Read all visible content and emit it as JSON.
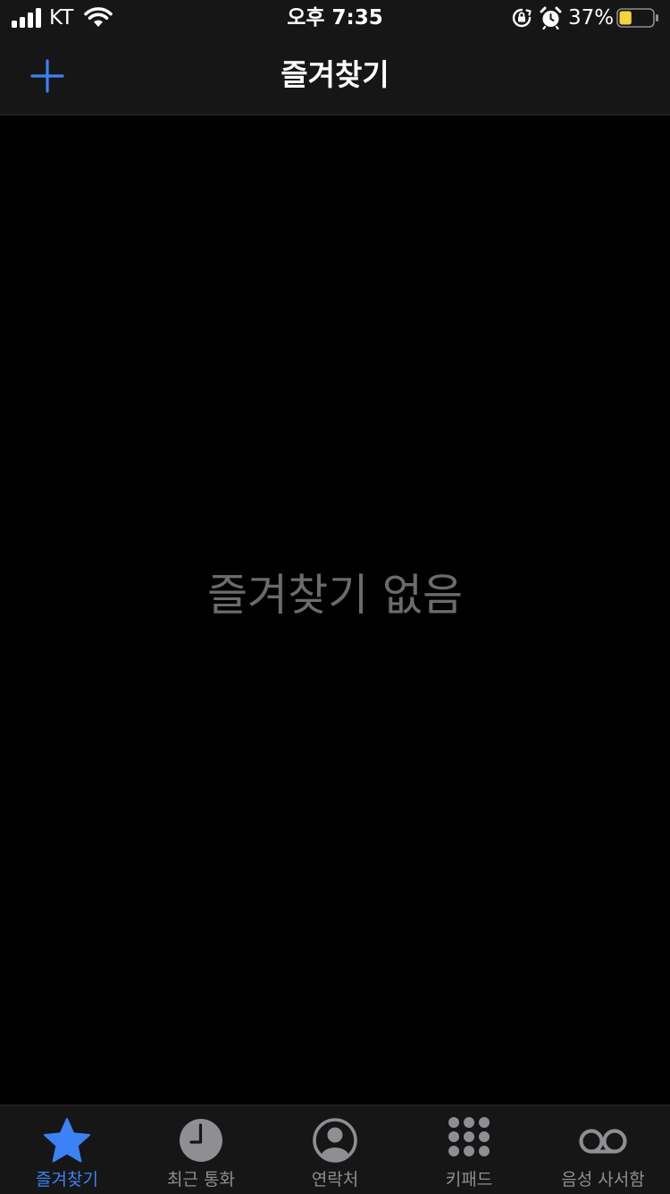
{
  "status_bar": {
    "carrier": "KT",
    "time": "오후 7:35",
    "battery_percent": "37%",
    "battery_level": 0.37,
    "battery_color": "#f5d33d"
  },
  "nav": {
    "title": "즐겨찾기",
    "add_icon": "plus-icon"
  },
  "main": {
    "empty_message": "즐겨찾기 없음"
  },
  "tabs": [
    {
      "label": "즐겨찾기",
      "icon": "star-icon",
      "active": true
    },
    {
      "label": "최근 통화",
      "icon": "clock-icon",
      "active": false
    },
    {
      "label": "연락처",
      "icon": "contact-icon",
      "active": false
    },
    {
      "label": "키패드",
      "icon": "keypad-icon",
      "active": false
    },
    {
      "label": "음성 사서함",
      "icon": "voicemail-icon",
      "active": false
    }
  ],
  "colors": {
    "accent": "#3b82f6",
    "inactive": "#8e8e93",
    "bar_background": "#161616",
    "background": "#000000",
    "empty_text": "#6b6b6b"
  }
}
